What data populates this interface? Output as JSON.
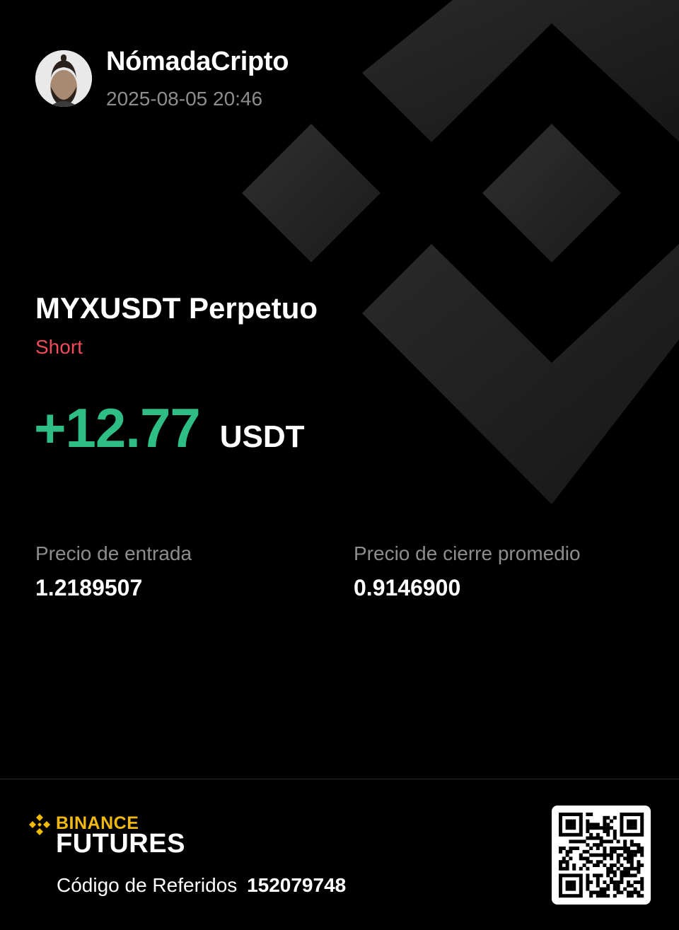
{
  "user": {
    "name": "NómadaCripto",
    "datetime": "2025-08-05 20:46"
  },
  "position": {
    "pair": "MYXUSDT Perpetuo",
    "side": "Short",
    "pnl": "+12.77",
    "pnl_unit": "USDT"
  },
  "stats": {
    "entry_label": "Precio de entrada",
    "entry_value": "1.2189507",
    "close_label": "Precio de cierre promedio",
    "close_value": "0.9146900"
  },
  "footer": {
    "brand_name": "BINANCE",
    "brand_product": "FUTURES",
    "referral_label": "Código de Referidos",
    "referral_code": "152079748"
  },
  "colors": {
    "background": "#000000",
    "profit": "#2ebd85",
    "short": "#f04b5a",
    "brand": "#f0b90b",
    "muted_text": "#8d8d8d"
  },
  "icons": {
    "avatar": "avatar",
    "background": "binance-logo-icon",
    "brand": "binance-diamond-icon",
    "qr": "qr-code-icon"
  }
}
